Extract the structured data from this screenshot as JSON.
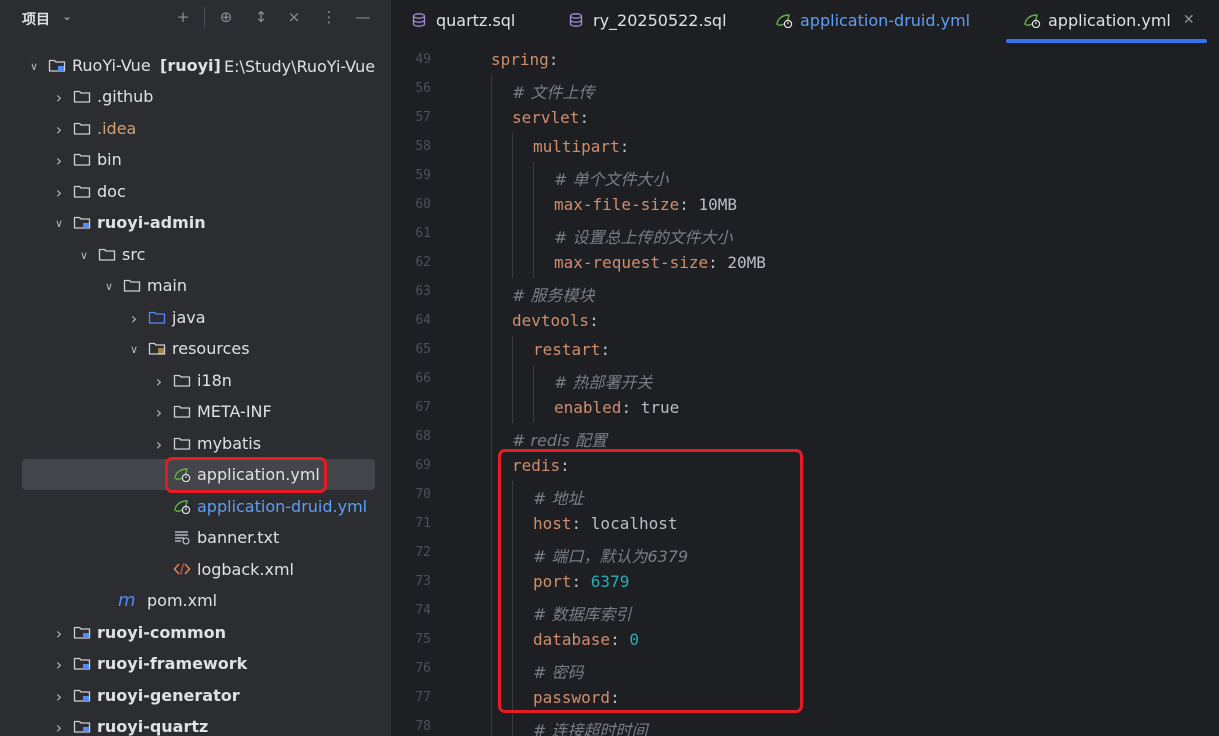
{
  "project_panel": {
    "title": "项目",
    "tree": [
      {
        "label": "RuoYi-Vue",
        "suffix": "[ruoyi]",
        "path": "E:\\Study\\RuoYi-Vue",
        "icon": "module-folder-icon",
        "expanded": true
      },
      {
        "label": ".github",
        "icon": "folder-icon",
        "expanded": false
      },
      {
        "label": ".idea",
        "icon": "folder-icon",
        "expanded": false
      },
      {
        "label": "bin",
        "icon": "folder-icon",
        "expanded": false
      },
      {
        "label": "doc",
        "icon": "folder-icon",
        "expanded": false
      },
      {
        "label": "ruoyi-admin",
        "icon": "module-folder-icon",
        "expanded": true
      },
      {
        "label": "src",
        "icon": "folder-icon",
        "expanded": true
      },
      {
        "label": "main",
        "icon": "folder-icon",
        "expanded": true
      },
      {
        "label": "java",
        "icon": "source-folder-icon",
        "expanded": false
      },
      {
        "label": "resources",
        "icon": "resources-folder-icon",
        "expanded": true
      },
      {
        "label": "i18n",
        "icon": "folder-icon",
        "expanded": false
      },
      {
        "label": "META-INF",
        "icon": "folder-icon",
        "expanded": false
      },
      {
        "label": "mybatis",
        "icon": "folder-icon",
        "expanded": false
      },
      {
        "label": "application.yml",
        "icon": "spring-yaml-icon",
        "selected": true
      },
      {
        "label": "application-druid.yml",
        "icon": "spring-yaml-icon"
      },
      {
        "label": "banner.txt",
        "icon": "text-file-icon"
      },
      {
        "label": "logback.xml",
        "icon": "xml-file-icon"
      },
      {
        "label": "pom.xml",
        "icon": "maven-icon"
      },
      {
        "label": "ruoyi-common",
        "icon": "module-folder-icon",
        "expanded": false
      },
      {
        "label": "ruoyi-framework",
        "icon": "module-folder-icon",
        "expanded": false
      },
      {
        "label": "ruoyi-generator",
        "icon": "module-folder-icon",
        "expanded": false
      },
      {
        "label": "ruoyi-quartz",
        "icon": "module-folder-icon",
        "expanded": false
      }
    ]
  },
  "tabs": [
    {
      "label": "quartz.sql",
      "icon": "database-icon"
    },
    {
      "label": "ry_20250522.sql",
      "icon": "database-icon"
    },
    {
      "label": "application-druid.yml",
      "icon": "spring-yaml-icon"
    },
    {
      "label": "application.yml",
      "icon": "spring-yaml-icon",
      "active": true
    }
  ],
  "code_lines": [
    {
      "n": "49",
      "tokens": [
        {
          "t": "spring",
          "c": "k"
        },
        {
          "t": ":",
          "c": "p"
        }
      ]
    },
    {
      "n": "56",
      "tokens": [
        {
          "t": "# 文件上传",
          "c": "c"
        }
      ]
    },
    {
      "n": "57",
      "tokens": [
        {
          "t": "servlet",
          "c": "k"
        },
        {
          "t": ":",
          "c": "p"
        }
      ]
    },
    {
      "n": "58",
      "tokens": [
        {
          "t": "multipart",
          "c": "k"
        },
        {
          "t": ":",
          "c": "p"
        }
      ]
    },
    {
      "n": "59",
      "tokens": [
        {
          "t": "# 单个文件大小",
          "c": "c"
        }
      ]
    },
    {
      "n": "60",
      "tokens": [
        {
          "t": "max-file-size",
          "c": "k"
        },
        {
          "t": ": ",
          "c": "p"
        },
        {
          "t": "10MB",
          "c": "v"
        }
      ]
    },
    {
      "n": "61",
      "tokens": [
        {
          "t": "# 设置总上传的文件大小",
          "c": "c"
        }
      ]
    },
    {
      "n": "62",
      "tokens": [
        {
          "t": "max-request-size",
          "c": "k"
        },
        {
          "t": ": ",
          "c": "p"
        },
        {
          "t": "20MB",
          "c": "v"
        }
      ]
    },
    {
      "n": "63",
      "tokens": [
        {
          "t": "# 服务模块",
          "c": "c"
        }
      ]
    },
    {
      "n": "64",
      "tokens": [
        {
          "t": "devtools",
          "c": "k"
        },
        {
          "t": ":",
          "c": "p"
        }
      ]
    },
    {
      "n": "65",
      "tokens": [
        {
          "t": "restart",
          "c": "k"
        },
        {
          "t": ":",
          "c": "p"
        }
      ]
    },
    {
      "n": "66",
      "tokens": [
        {
          "t": "# 热部署开关",
          "c": "c"
        }
      ]
    },
    {
      "n": "67",
      "tokens": [
        {
          "t": "enabled",
          "c": "k"
        },
        {
          "t": ": ",
          "c": "p"
        },
        {
          "t": "true",
          "c": "v"
        }
      ]
    },
    {
      "n": "68",
      "tokens": [
        {
          "t": "# redis 配置",
          "c": "c"
        }
      ]
    },
    {
      "n": "69",
      "tokens": [
        {
          "t": "redis",
          "c": "k"
        },
        {
          "t": ":",
          "c": "p"
        }
      ]
    },
    {
      "n": "70",
      "tokens": [
        {
          "t": "# 地址",
          "c": "c"
        }
      ]
    },
    {
      "n": "71",
      "tokens": [
        {
          "t": "host",
          "c": "k"
        },
        {
          "t": ": ",
          "c": "p"
        },
        {
          "t": "localhost",
          "c": "v"
        }
      ]
    },
    {
      "n": "72",
      "tokens": [
        {
          "t": "# 端口，默认为6379",
          "c": "c"
        }
      ]
    },
    {
      "n": "73",
      "tokens": [
        {
          "t": "port",
          "c": "k"
        },
        {
          "t": ": ",
          "c": "p"
        },
        {
          "t": "6379",
          "c": "n"
        }
      ]
    },
    {
      "n": "74",
      "tokens": [
        {
          "t": "# 数据库索引",
          "c": "c"
        }
      ]
    },
    {
      "n": "75",
      "tokens": [
        {
          "t": "database",
          "c": "k"
        },
        {
          "t": ": ",
          "c": "p"
        },
        {
          "t": "0",
          "c": "n"
        }
      ]
    },
    {
      "n": "76",
      "tokens": [
        {
          "t": "# 密码",
          "c": "c"
        }
      ]
    },
    {
      "n": "77",
      "tokens": [
        {
          "t": "password",
          "c": "k"
        },
        {
          "t": ":",
          "c": "p"
        }
      ]
    },
    {
      "n": "78",
      "tokens": [
        {
          "t": "# 连接超时时间",
          "c": "c"
        }
      ]
    }
  ],
  "colors": {
    "highlight": "#e51c23",
    "accent": "#3574f0",
    "yaml_key": "#cf8e6d",
    "number": "#2aacb8",
    "comment": "#7a7e85"
  }
}
